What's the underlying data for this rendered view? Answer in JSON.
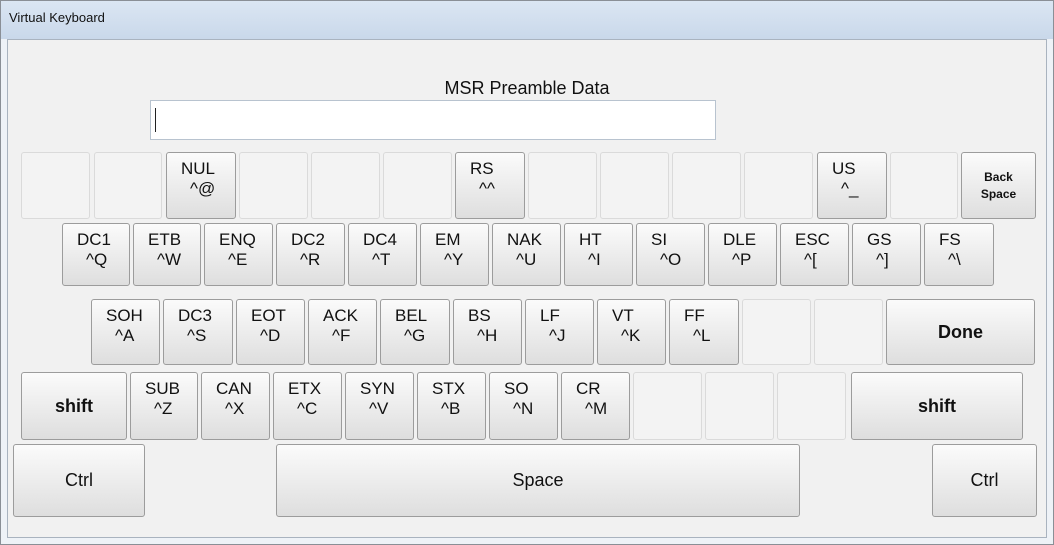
{
  "window": {
    "title": "Virtual Keyboard"
  },
  "form": {
    "label": "MSR Preamble Data",
    "value": ""
  },
  "keys": {
    "r1_0": {
      "l1": "",
      "l2": ""
    },
    "r1_1": {
      "l1": "",
      "l2": ""
    },
    "r1_2": {
      "l1": "NUL",
      "l2": "^@"
    },
    "r1_3": {
      "l1": "",
      "l2": ""
    },
    "r1_4": {
      "l1": "",
      "l2": ""
    },
    "r1_5": {
      "l1": "",
      "l2": ""
    },
    "r1_6": {
      "l1": "RS",
      "l2": "^^"
    },
    "r1_7": {
      "l1": "",
      "l2": ""
    },
    "r1_8": {
      "l1": "",
      "l2": ""
    },
    "r1_9": {
      "l1": "",
      "l2": ""
    },
    "r1_10": {
      "l1": "",
      "l2": ""
    },
    "r1_11": {
      "l1": "US",
      "l2": "^_"
    },
    "r1_12": {
      "l1": "",
      "l2": ""
    },
    "r1_back": {
      "label": "Back\nSpace"
    },
    "r2_0": {
      "l1": "DC1",
      "l2": "^Q"
    },
    "r2_1": {
      "l1": "ETB",
      "l2": "^W"
    },
    "r2_2": {
      "l1": "ENQ",
      "l2": "^E"
    },
    "r2_3": {
      "l1": "DC2",
      "l2": "^R"
    },
    "r2_4": {
      "l1": "DC4",
      "l2": "^T"
    },
    "r2_5": {
      "l1": "EM",
      "l2": "^Y"
    },
    "r2_6": {
      "l1": "NAK",
      "l2": "^U"
    },
    "r2_7": {
      "l1": "HT",
      "l2": "^I"
    },
    "r2_8": {
      "l1": "SI",
      "l2": "^O"
    },
    "r2_9": {
      "l1": "DLE",
      "l2": "^P"
    },
    "r2_10": {
      "l1": "ESC",
      "l2": "^["
    },
    "r2_11": {
      "l1": "GS",
      "l2": "^]"
    },
    "r2_12": {
      "l1": "FS",
      "l2": "^\\"
    },
    "r3_0": {
      "l1": "SOH",
      "l2": "^A"
    },
    "r3_1": {
      "l1": "DC3",
      "l2": "^S"
    },
    "r3_2": {
      "l1": "EOT",
      "l2": "^D"
    },
    "r3_3": {
      "l1": "ACK",
      "l2": "^F"
    },
    "r3_4": {
      "l1": "BEL",
      "l2": "^G"
    },
    "r3_5": {
      "l1": "BS",
      "l2": "^H"
    },
    "r3_6": {
      "l1": "LF",
      "l2": "^J"
    },
    "r3_7": {
      "l1": "VT",
      "l2": "^K"
    },
    "r3_8": {
      "l1": "FF",
      "l2": "^L"
    },
    "r3_9": {
      "l1": "",
      "l2": ""
    },
    "r3_10": {
      "l1": "",
      "l2": ""
    },
    "r3_done": {
      "label": "Done"
    },
    "r4_shift_left": {
      "label": "shift"
    },
    "r4_0": {
      "l1": "SUB",
      "l2": "^Z"
    },
    "r4_1": {
      "l1": "CAN",
      "l2": "^X"
    },
    "r4_2": {
      "l1": "ETX",
      "l2": "^C"
    },
    "r4_3": {
      "l1": "SYN",
      "l2": "^V"
    },
    "r4_4": {
      "l1": "STX",
      "l2": "^B"
    },
    "r4_5": {
      "l1": "SO",
      "l2": "^N"
    },
    "r4_6": {
      "l1": "CR",
      "l2": "^M"
    },
    "r4_7": {
      "l1": "",
      "l2": ""
    },
    "r4_8": {
      "l1": "",
      "l2": ""
    },
    "r4_9": {
      "l1": "",
      "l2": ""
    },
    "r4_shift_right": {
      "label": "shift"
    },
    "r5_ctrl_left": {
      "label": "Ctrl"
    },
    "r5_space": {
      "label": "Space"
    },
    "r5_ctrl_right": {
      "label": "Ctrl"
    }
  }
}
